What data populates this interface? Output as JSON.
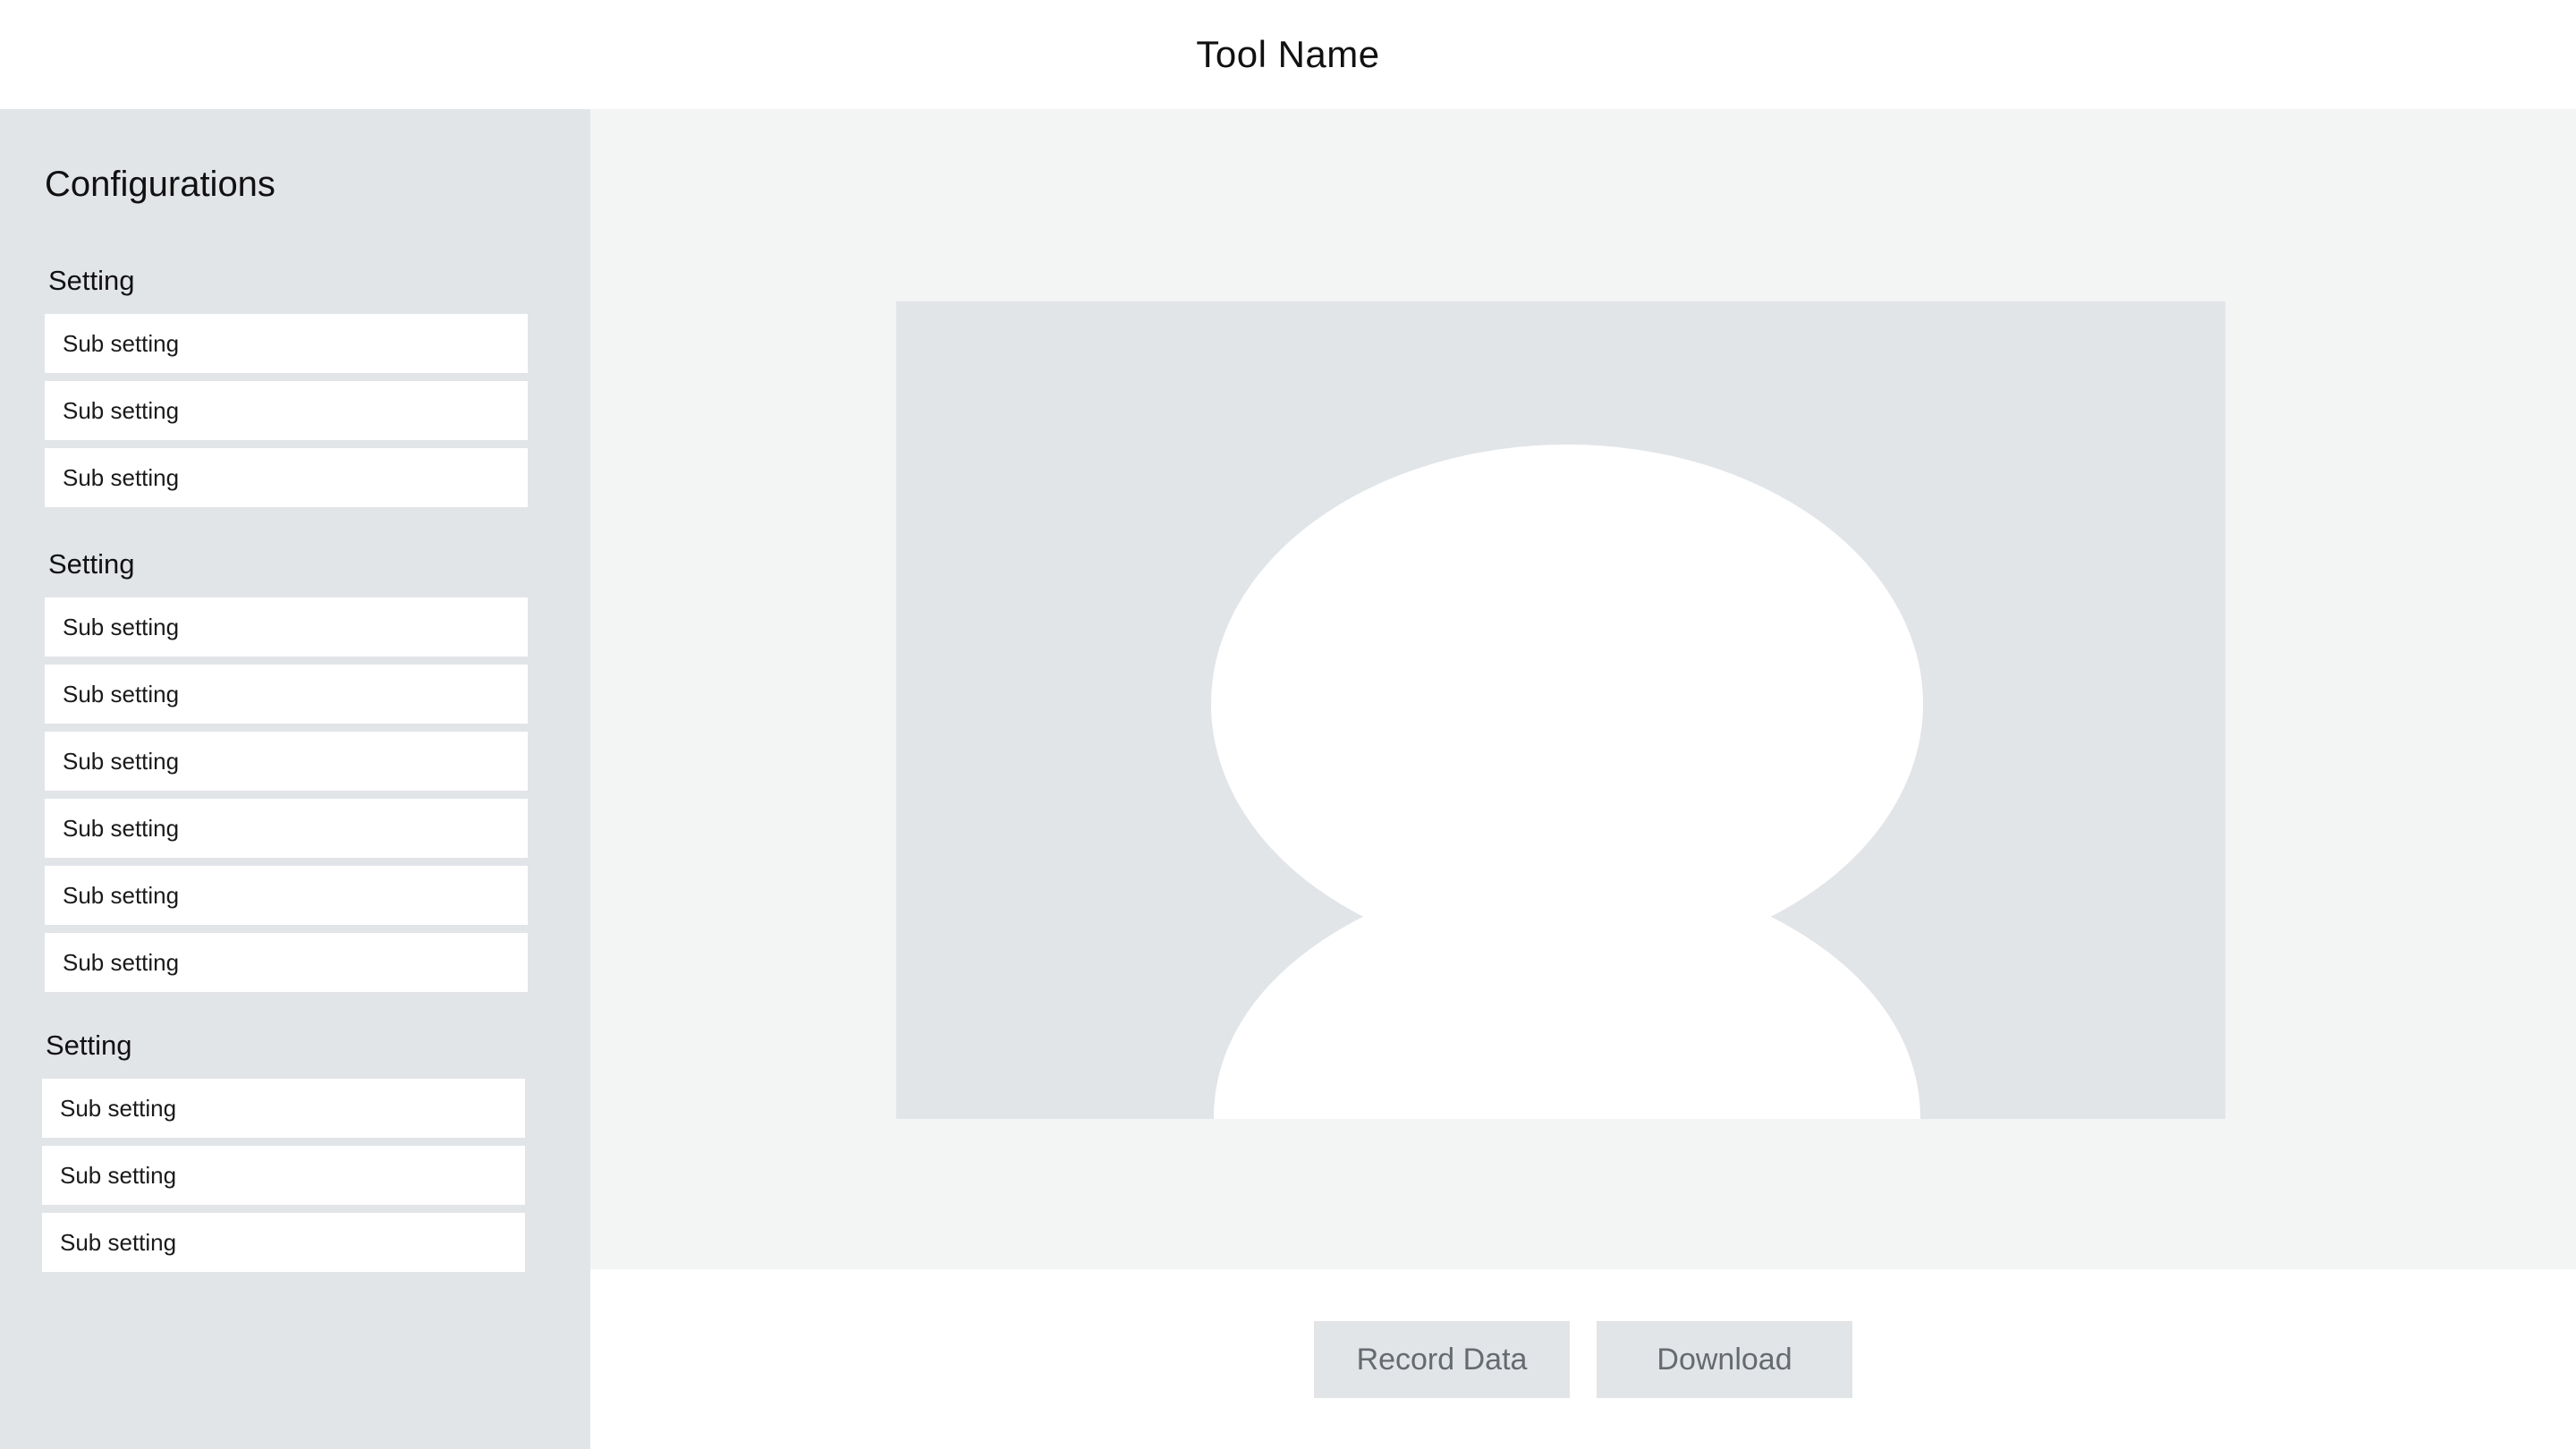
{
  "header": {
    "title": "Tool Name"
  },
  "sidebar": {
    "heading": "Configurations",
    "groups": [
      {
        "label": "Setting",
        "items": [
          "Sub setting",
          "Sub setting",
          "Sub setting"
        ]
      },
      {
        "label": "Setting",
        "items": [
          "Sub setting",
          "Sub setting",
          "Sub setting",
          "Sub setting",
          "Sub setting",
          "Sub setting"
        ]
      },
      {
        "label": "Setting",
        "items": [
          "Sub setting",
          "Sub setting",
          "Sub setting"
        ]
      }
    ]
  },
  "preview": {
    "icon": "user-avatar-placeholder-icon"
  },
  "actions": {
    "record_label": "Record Data",
    "download_label": "Download"
  },
  "colors": {
    "sidebar_bg": "#e2e5e8",
    "main_bg": "#f3f4f4",
    "button_bg": "#e2e5e8",
    "button_text": "#666b70"
  }
}
